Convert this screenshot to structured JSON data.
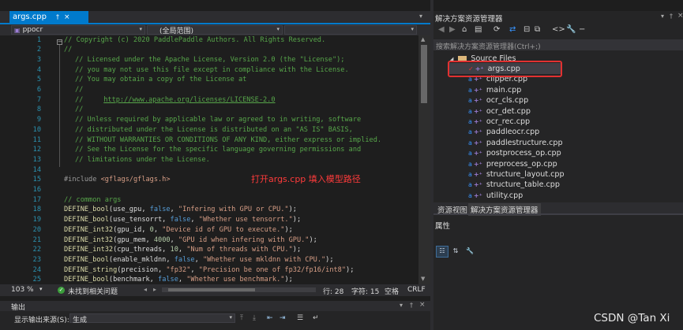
{
  "editor": {
    "tab": {
      "filename": "args.cpp",
      "pin": "†",
      "close": "×"
    },
    "nav": {
      "project": "ppocr",
      "scope": "(全局范围)"
    },
    "line_numbers": [
      "1",
      "2",
      "3",
      "4",
      "5",
      "6",
      "7",
      "8",
      "9",
      "10",
      "11",
      "12",
      "13",
      "14",
      "15",
      "16",
      "17",
      "18",
      "19",
      "20",
      "21",
      "22",
      "23",
      "24",
      "25"
    ],
    "lines": [
      [
        [
          "cm",
          "// Copyright (c) 2020 PaddlePaddle Authors. All Rights Reserved."
        ]
      ],
      [
        [
          "cm",
          "//"
        ]
      ],
      [
        [
          "cm",
          "// Licensed under the Apache License, Version 2.0 (the \"License\");"
        ]
      ],
      [
        [
          "cm",
          "// you may not use this file except in compliance with the License."
        ]
      ],
      [
        [
          "cm",
          "// You may obtain a copy of the License at"
        ]
      ],
      [
        [
          "cm",
          "//"
        ]
      ],
      [
        [
          "cm",
          "//     "
        ],
        [
          "lnk",
          "http://www.apache.org/licenses/LICENSE-2.0"
        ]
      ],
      [
        [
          "cm",
          "//"
        ]
      ],
      [
        [
          "cm",
          "// Unless required by applicable law or agreed to in writing, software"
        ]
      ],
      [
        [
          "cm",
          "// distributed under the License is distributed on an \"AS IS\" BASIS,"
        ]
      ],
      [
        [
          "cm",
          "// WITHOUT WARRANTIES OR CONDITIONS OF ANY KIND, either express or implied."
        ]
      ],
      [
        [
          "cm",
          "// See the License for the specific language governing permissions and"
        ]
      ],
      [
        [
          "cm",
          "// limitations under the License."
        ]
      ],
      [
        [
          "",
          ""
        ]
      ],
      [
        [
          "pre",
          "#include "
        ],
        [
          "inc",
          "<gflags/gflags.h>"
        ]
      ],
      [
        [
          "",
          ""
        ]
      ],
      [
        [
          "cm",
          "// common args"
        ]
      ],
      [
        [
          "fn",
          "DEFINE_bool"
        ],
        [
          "",
          "(use_gpu, "
        ],
        [
          "kw",
          "false"
        ],
        [
          "",
          ", "
        ],
        [
          "str",
          "\"Infering with GPU or CPU.\""
        ],
        [
          "",
          ");"
        ]
      ],
      [
        [
          "fn",
          "DEFINE_bool"
        ],
        [
          "",
          "(use_tensorrt, "
        ],
        [
          "kw",
          "false"
        ],
        [
          "",
          ", "
        ],
        [
          "str",
          "\"Whether use tensorrt.\""
        ],
        [
          "",
          ");"
        ]
      ],
      [
        [
          "fn",
          "DEFINE_int32"
        ],
        [
          "",
          "(gpu_id, "
        ],
        [
          "num",
          "0"
        ],
        [
          "",
          ", "
        ],
        [
          "str",
          "\"Device id of GPU to execute.\""
        ],
        [
          "",
          ");"
        ]
      ],
      [
        [
          "fn",
          "DEFINE_int32"
        ],
        [
          "",
          "(gpu_mem, "
        ],
        [
          "num",
          "4000"
        ],
        [
          "",
          ", "
        ],
        [
          "str",
          "\"GPU id when infering with GPU.\""
        ],
        [
          "",
          ");"
        ]
      ],
      [
        [
          "fn",
          "DEFINE_int32"
        ],
        [
          "",
          "(cpu_threads, "
        ],
        [
          "num",
          "10"
        ],
        [
          "",
          ", "
        ],
        [
          "str",
          "\"Num of threads with CPU.\""
        ],
        [
          "",
          ");"
        ]
      ],
      [
        [
          "fn",
          "DEFINE_bool"
        ],
        [
          "",
          "(enable_mkldnn, "
        ],
        [
          "kw",
          "false"
        ],
        [
          "",
          ", "
        ],
        [
          "str",
          "\"Whether use mkldnn with CPU.\""
        ],
        [
          "",
          ");"
        ]
      ],
      [
        [
          "fn",
          "DEFINE_string"
        ],
        [
          "",
          "(precision, "
        ],
        [
          "str",
          "\"fp32\""
        ],
        [
          "",
          ", "
        ],
        [
          "str",
          "\"Precision be one of fp32/fp16/int8\""
        ],
        [
          "",
          ");"
        ]
      ],
      [
        [
          "fn",
          "DEFINE_bool"
        ],
        [
          "",
          "(benchmark, "
        ],
        [
          "kw",
          "false"
        ],
        [
          "",
          ", "
        ],
        [
          "str",
          "\"Whether use benchmark.\""
        ],
        [
          "",
          ");"
        ]
      ]
    ],
    "annotation": "打开args.cpp 填入模型路径"
  },
  "status": {
    "zoom": "103 %",
    "issues": "未找到相关问题",
    "line": "行: 28",
    "char": "字符: 15",
    "space": "空格",
    "eol": "CRLF"
  },
  "output": {
    "title": "输出",
    "source_label": "显示输出来源(S):",
    "source_value": "生成"
  },
  "solution_explorer": {
    "title": "解决方案资源管理器",
    "search_placeholder": "搜索解决方案资源管理器(Ctrl+;)",
    "folder": "Source Files",
    "files": [
      "args.cpp",
      "clipper.cpp",
      "main.cpp",
      "ocr_cls.cpp",
      "ocr_det.cpp",
      "ocr_rec.cpp",
      "paddleocr.cpp",
      "paddlestructure.cpp",
      "postprocess_op.cpp",
      "preprocess_op.cpp",
      "structure_layout.cpp",
      "structure_table.cpp",
      "utility.cpp"
    ],
    "tabs": [
      "资源视图",
      "解决方案资源管理器"
    ],
    "properties_title": "属性"
  },
  "watermark": "CSDN @Tan Xi",
  "colors": {
    "accent": "#007acc",
    "highlight_box": "#e23131",
    "annotation": "#ff3b3b"
  }
}
